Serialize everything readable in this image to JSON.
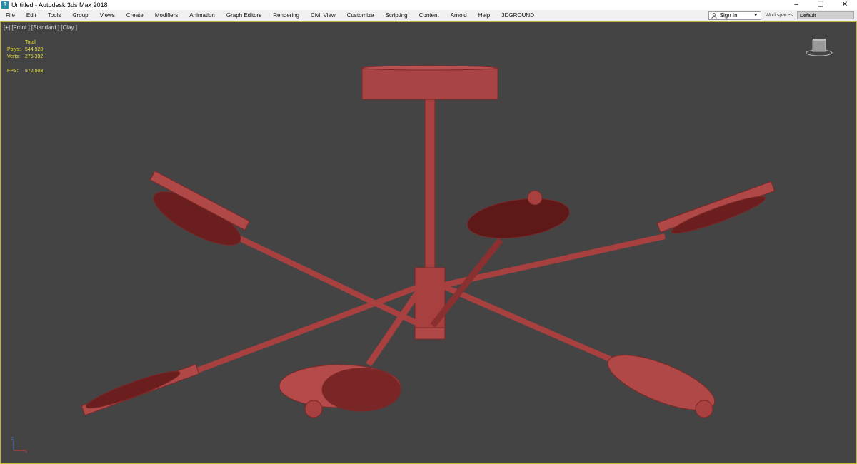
{
  "window": {
    "title": "Untitled - Autodesk 3ds Max 2018"
  },
  "menu": [
    "File",
    "Edit",
    "Tools",
    "Group",
    "Views",
    "Create",
    "Modifiers",
    "Animation",
    "Graph Editors",
    "Rendering",
    "Civil View",
    "Customize",
    "Scripting",
    "Content",
    "Arnold",
    "Help",
    "3DGROUND"
  ],
  "signin": {
    "label": "Sign In"
  },
  "workspaces": {
    "label": "Workspaces:",
    "value": "Default"
  },
  "viewport": {
    "label": "[+] [Front ] [Standard ] [Clay ]",
    "stats": {
      "header": "Total",
      "polys_label": "Polys:",
      "polys": "544 928",
      "verts_label": "Verts:",
      "verts": "275 392",
      "fps_label": "FPS:",
      "fps": "572,508"
    }
  },
  "colors": {
    "model": "#a84040",
    "viewport_bg": "#444444",
    "stats_text": "#e8e23a",
    "active_border": "#c7b33a"
  }
}
